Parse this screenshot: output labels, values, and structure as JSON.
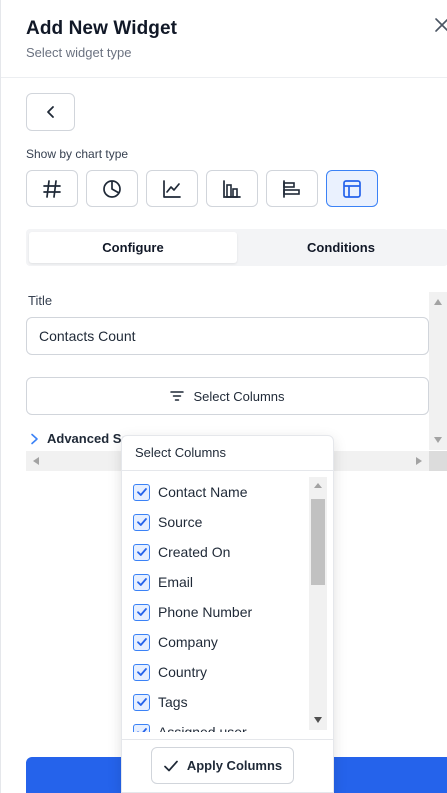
{
  "header": {
    "title": "Add New Widget",
    "subtitle": "Select widget type",
    "close_icon": "close-icon"
  },
  "back_button": {
    "icon": "chevron-left-icon"
  },
  "chart_type": {
    "label": "Show by chart type",
    "options": [
      {
        "icon": "hash-icon",
        "selected": false
      },
      {
        "icon": "pie-chart-icon",
        "selected": false
      },
      {
        "icon": "line-chart-icon",
        "selected": false
      },
      {
        "icon": "bar-chart-icon",
        "selected": false
      },
      {
        "icon": "horizontal-bar-chart-icon",
        "selected": false
      },
      {
        "icon": "table-icon",
        "selected": true
      }
    ]
  },
  "tabs": [
    {
      "label": "Configure",
      "active": true
    },
    {
      "label": "Conditions",
      "active": false
    }
  ],
  "form": {
    "title_label": "Title",
    "title_value": "Contacts Count",
    "select_columns_label": "Select Columns",
    "advanced_settings_label": "Advanced Se"
  },
  "column_picker": {
    "title": "Select Columns",
    "items": [
      {
        "label": "Contact Name",
        "checked": true
      },
      {
        "label": "Source",
        "checked": true
      },
      {
        "label": "Created On",
        "checked": true
      },
      {
        "label": "Email",
        "checked": true
      },
      {
        "label": "Phone Number",
        "checked": true
      },
      {
        "label": "Company",
        "checked": true
      },
      {
        "label": "Country",
        "checked": true
      },
      {
        "label": "Tags",
        "checked": true
      },
      {
        "label": "Assigned user",
        "checked": true
      }
    ],
    "apply_label": "Apply Columns"
  },
  "colors": {
    "accent": "#2563eb",
    "checkbox_border": "#3b82f6",
    "active_chip_bg": "#eaf1fe"
  }
}
